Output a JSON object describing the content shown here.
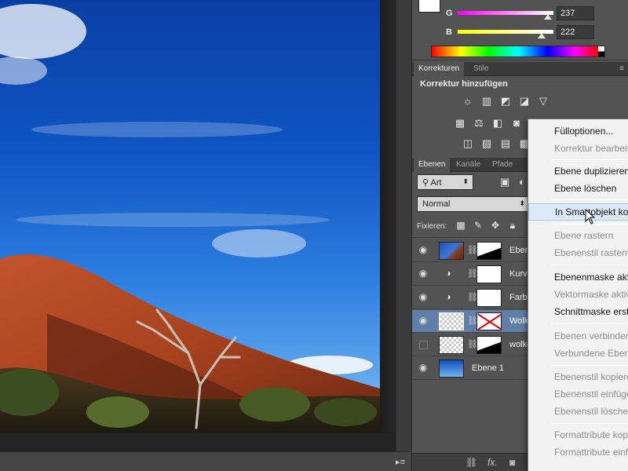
{
  "color_panel": {
    "channels": [
      {
        "label": "G",
        "value": "237"
      },
      {
        "label": "B",
        "value": "222"
      }
    ],
    "foreground_color": "#ffffff"
  },
  "adjustments": {
    "tabs": [
      {
        "label": "Korrekturen"
      },
      {
        "label": "Stile"
      }
    ],
    "title": "Korrektur hinzufügen",
    "icons_row1": [
      "brightness-icon",
      "levels-icon",
      "curves-icon",
      "exposure-icon",
      "vibrance-icon"
    ],
    "icons_row2": [
      "hue-saturation-icon",
      "color-balance-icon",
      "black-white-icon",
      "photo-filter-icon",
      "channel-mixer-icon",
      "color-lookup-icon"
    ],
    "icons_row3": [
      "invert-icon",
      "posterize-icon",
      "threshold-icon",
      "gradient-map-icon",
      "selective-color-icon"
    ]
  },
  "layers": {
    "tabs": [
      {
        "label": "Ebenen"
      },
      {
        "label": "Kanäle"
      },
      {
        "label": "Pfade"
      }
    ],
    "filter": "Art",
    "blend_mode": "Normal",
    "lock_label": "Fixieren:",
    "rows": [
      {
        "name": "Eben",
        "visible": true
      },
      {
        "name": "Kurve",
        "visible": true
      },
      {
        "name": "Farbt",
        "visible": true
      },
      {
        "name": "Wolke",
        "visible": true,
        "selected": true
      },
      {
        "name": "wolke",
        "visible": false
      },
      {
        "name": "Ebene 1",
        "visible": true
      }
    ],
    "footer_fx": "fx."
  },
  "context_menu": {
    "items": [
      {
        "label": "Fülloptionen...",
        "enabled": true
      },
      {
        "label": "Korrektur bearbeit",
        "enabled": false
      },
      {
        "label": "Ebene duplizieren",
        "enabled": true
      },
      {
        "label": "Ebene löschen",
        "enabled": true
      },
      {
        "label": "In Smartobjekt ko",
        "enabled": true,
        "hover": true
      },
      {
        "label": "Ebene rastern",
        "enabled": false
      },
      {
        "label": "Ebenenstil rastern",
        "enabled": false
      },
      {
        "label": "Ebenenmaske akti",
        "enabled": true
      },
      {
        "label": "Vektormaske aktiv",
        "enabled": false
      },
      {
        "label": "Schnittmaske erst",
        "enabled": true
      },
      {
        "label": "Ebenen verbinden",
        "enabled": false
      },
      {
        "label": "Verbundene Eben",
        "enabled": false
      },
      {
        "label": "Ebenenstil kopiere",
        "enabled": false
      },
      {
        "label": "Ebenenstil einfüge",
        "enabled": false
      },
      {
        "label": "Ebenenstil lösche",
        "enabled": false
      },
      {
        "label": "Formattribute kop",
        "enabled": false
      },
      {
        "label": "Formattribute einf",
        "enabled": false
      }
    ]
  }
}
